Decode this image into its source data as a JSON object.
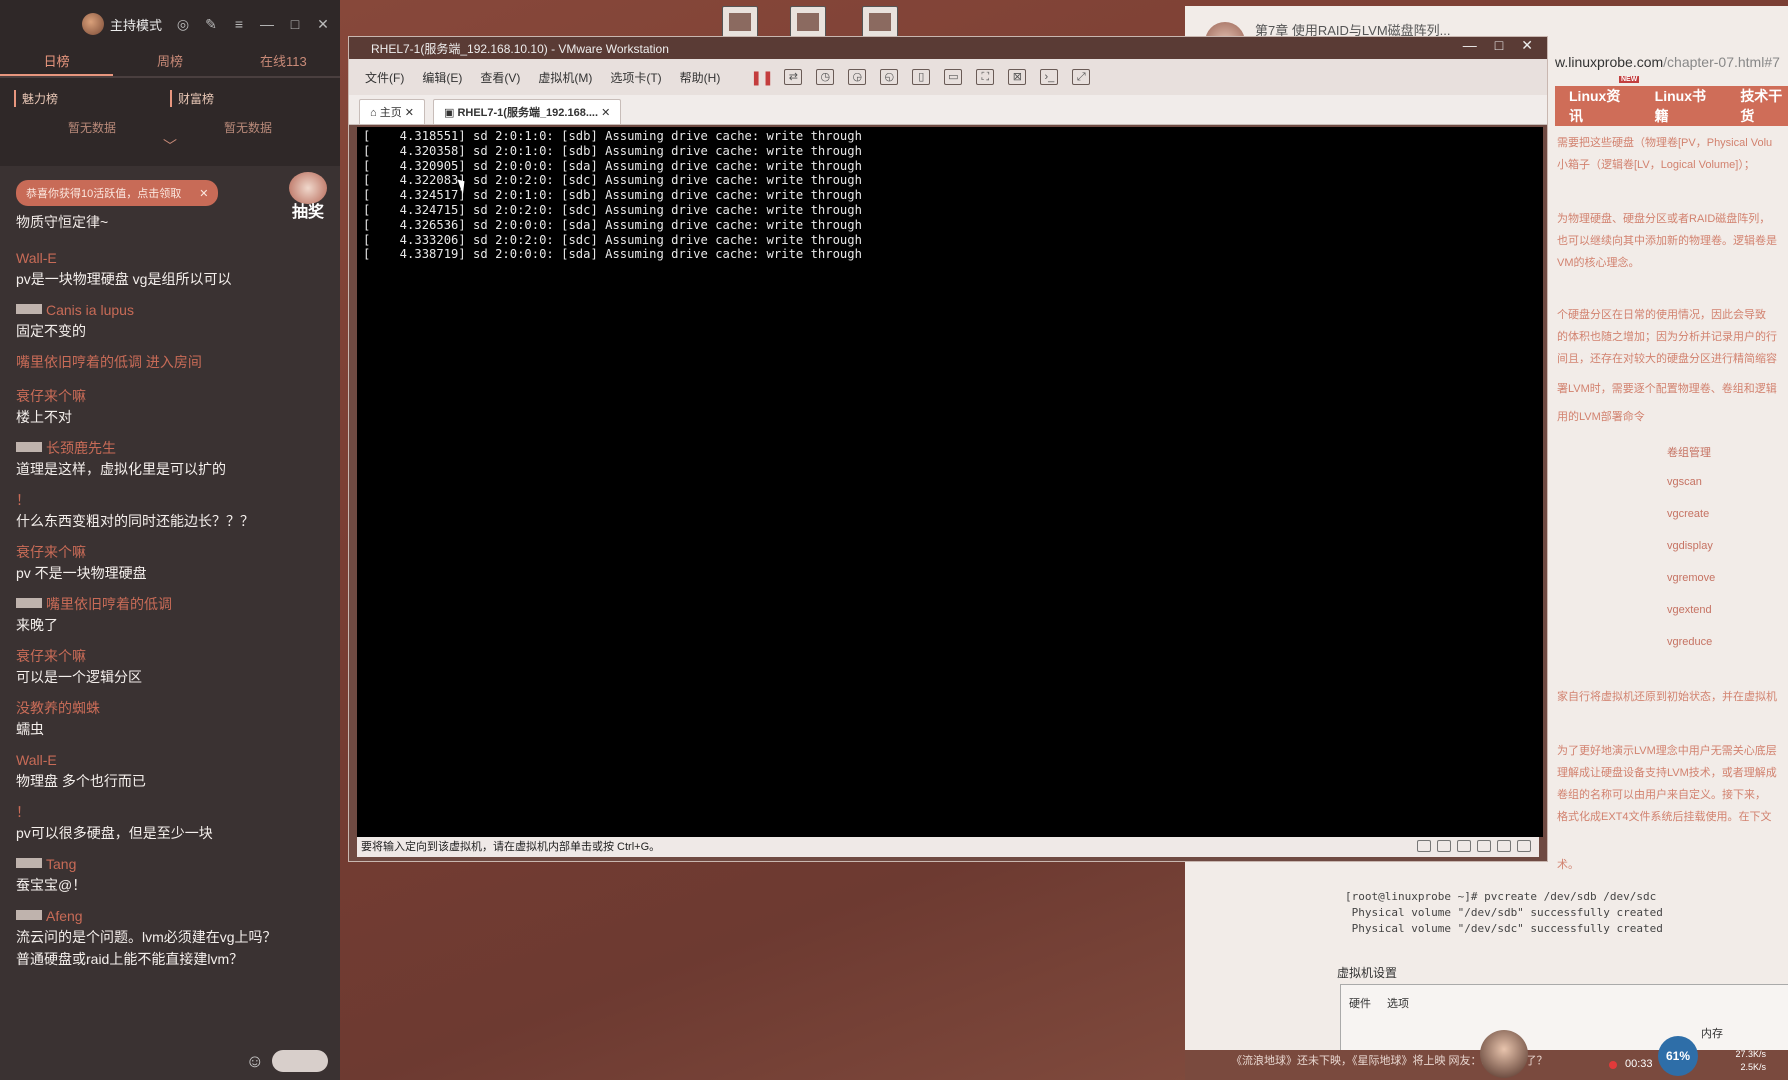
{
  "live_panel": {
    "mode": "主持模式",
    "tabs": [
      "日榜",
      "周榜",
      "在线113"
    ],
    "ranks": [
      {
        "title": "魅力榜",
        "value": "暂无数据"
      },
      {
        "title": "财富榜",
        "value": "暂无数据"
      }
    ],
    "notice": "恭喜你获得10活跃值，点击领取",
    "lottery_label": "抽奖",
    "first_msg": "物质守恒定律~",
    "messages": [
      {
        "user": "Wall-E",
        "text": "pv是一块物理硬盘 vg是组所以可以"
      },
      {
        "user": "Canis ia lupus",
        "text": "固定不变的",
        "badge": true
      },
      {
        "enter": "嘴里依旧哼着的低调 进入房间"
      },
      {
        "user": "衰仔来个嘛",
        "text": "楼上不对"
      },
      {
        "user": "长颈鹿先生",
        "text": "道理是这样，虚拟化里是可以扩的",
        "badge": true
      },
      {
        "user": "！",
        "text": "什么东西变粗对的同时还能边长？？？"
      },
      {
        "user": "衰仔来个嘛",
        "text": "pv 不是一块物理硬盘"
      },
      {
        "user": "嘴里依旧哼着的低调",
        "text": "来晚了",
        "badge": true
      },
      {
        "user": "衰仔来个嘛",
        "text": "可以是一个逻辑分区"
      },
      {
        "user": "没教养的蜘蛛",
        "text": "蠕虫"
      },
      {
        "user": "Wall-E",
        "text": "物理盘 多个也行而已"
      },
      {
        "user": "！",
        "text": "pv可以很多硬盘，但是至少一块"
      },
      {
        "user": "Tang",
        "text": "蚕宝宝@！",
        "badge": true
      },
      {
        "user": "Afeng",
        "text": "流云问的是个问题。lvm必须建在vg上吗？",
        "text2": "普通硬盘或raid上能不能直接建lvm？",
        "badge": true
      }
    ]
  },
  "vmware": {
    "title": "RHEL7-1(服务端_192.168.10.10) - VMware Workstation",
    "menu": [
      "文件(F)",
      "编辑(E)",
      "查看(V)",
      "虚拟机(M)",
      "选项卡(T)",
      "帮助(H)"
    ],
    "tabs": [
      "主页",
      "RHEL7-1(服务端_192.168...."
    ],
    "console_lines": [
      "[    4.318551] sd 2:0:1:0: [sdb] Assuming drive cache: write through",
      "[    4.320358] sd 2:0:1:0: [sdb] Assuming drive cache: write through",
      "[    4.320905] sd 2:0:0:0: [sda] Assuming drive cache: write through",
      "[    4.322083] sd 2:0:2:0: [sdc] Assuming drive cache: write through",
      "[    4.324517] sd 2:0:1:0: [sdb] Assuming drive cache: write through",
      "[    4.324715] sd 2:0:2:0: [sdc] Assuming drive cache: write through",
      "[    4.326536] sd 2:0:0:0: [sda] Assuming drive cache: write through",
      "[    4.333206] sd 2:0:2:0: [sdc] Assuming drive cache: write through",
      "[    4.338719] sd 2:0:0:0: [sda] Assuming drive cache: write through"
    ],
    "status": "要将输入定向到该虚拟机，请在虚拟机内部单击或按 Ctrl+G。"
  },
  "browser": {
    "tab_title": "第7章 使用RAID与LVM磁盘阵列...",
    "url_main": "w.linuxprobe.com",
    "url_dim": "/chapter-07.html#7",
    "nav": [
      "Linux资讯",
      "Linux书籍",
      "技术干货"
    ],
    "paragraphs": [
      "需要把这些硬盘（物理卷[PV，Physical Volu",
      "小箱子（逻辑卷[LV，Logical Volume]）；",
      "为物理硬盘、硬盘分区或者RAID磁盘阵列，",
      "也可以继续向其中添加新的物理卷。逻辑卷是",
      "VM的核心理念。",
      "个硬盘分区在日常的使用情况，因此会导致",
      "的体积也随之增加；因为分析并记录用户的行",
      "间且，还存在对较大的硬盘分区进行精简缩容",
      "署LVM时，需要逐个配置物理卷、卷组和逻辑",
      "用的LVM部署命令"
    ],
    "vg_header": "卷组管理",
    "vg_cmds": [
      "vgscan",
      "vgcreate",
      "vgdisplay",
      "vgremove",
      "vgextend",
      "vgreduce"
    ],
    "paragraphs2": [
      "家自行将虚拟机还原到初始状态，并在虚拟机",
      "为了更好地演示LVM理念中用户无需关心底层",
      "理解成让硬盘设备支持LVM技术，或者理解成",
      "卷组的名称可以由用户来自定义。接下来，",
      "格式化成EXT4文件系统后挂载使用。在下文"
    ],
    "p3": "术。",
    "shell": [
      "[root@linuxprobe ~]# pvcreate /dev/sdb /dev/sdc",
      " Physical volume \"/dev/sdb\" successfully created",
      " Physical volume \"/dev/sdc\" successfully created"
    ],
    "vm_settings": "虚拟机设置",
    "dialog_tabs": [
      "硬件",
      "选项"
    ],
    "dialog_mem": "内存"
  },
  "ticker": {
    "text": "《流浪地球》还未下映，《星际地球》将上映 网友：就是钱到了？",
    "time": "00:33"
  },
  "system": {
    "cpu": "61%",
    "up": "27.3K/s",
    "down": "2.5K/s"
  }
}
